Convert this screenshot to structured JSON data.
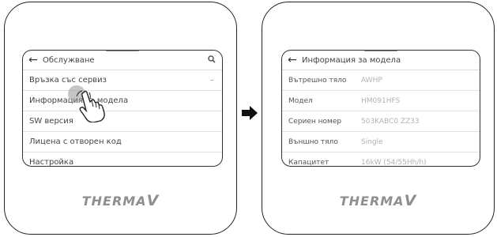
{
  "left_screen": {
    "title": "Обслужване",
    "back_icon": "arrow-left-icon",
    "search_icon": "search-icon",
    "menu": [
      {
        "label": "Връзка със сервиз",
        "trailing": "–"
      },
      {
        "label": "Информация за модела",
        "trailing": ""
      },
      {
        "label": "SW версия",
        "trailing": ""
      },
      {
        "label": "Лицена с отворен код",
        "trailing": ""
      },
      {
        "label": "Настройка",
        "trailing": ""
      }
    ],
    "brand": {
      "part1": "THERMA",
      "part2": "V"
    }
  },
  "right_screen": {
    "title": "Информация за модела",
    "back_icon": "arrow-left-icon",
    "rows": [
      {
        "key": "Вътрешно тяло",
        "value": "AWHP"
      },
      {
        "key": "Модел",
        "value": "HM091HFS"
      },
      {
        "key": "Сериен номер",
        "value": "503KABC0 ZZ33"
      },
      {
        "key": "Външно тяло",
        "value": "Single"
      },
      {
        "key": "Капацитет",
        "value": "16kW (54/55Hh/h)"
      }
    ],
    "brand": {
      "part1": "THERMA",
      "part2": "V"
    }
  },
  "transition_icon": "arrow-right-icon"
}
